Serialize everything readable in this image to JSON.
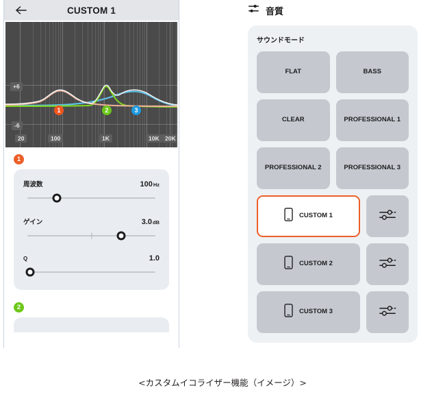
{
  "caption": "<カスタムイコライザー機能（イメージ）>",
  "phone": {
    "header": {
      "back_icon": "back-arrow-icon",
      "title": "CUSTOM 1"
    },
    "graph": {
      "y_labels": [
        "+6",
        "-6"
      ],
      "x_labels": [
        "20",
        "100",
        "1K",
        "10K",
        "20K"
      ],
      "markers": [
        {
          "label": "1",
          "color": "#f0561d"
        },
        {
          "label": "2",
          "color": "#6dc81a"
        },
        {
          "label": "3",
          "color": "#1f9be0"
        }
      ]
    },
    "bands": [
      {
        "badge": "1",
        "badge_color": "#ec5f28",
        "params": [
          {
            "label": "周波数",
            "value": "100",
            "unit": "Hz",
            "thumb_pct": 23,
            "has_center_tick": false
          },
          {
            "label": "ゲイン",
            "value": "3.0",
            "unit": "dB",
            "thumb_pct": 73,
            "has_center_tick": true
          },
          {
            "label": "Q",
            "value": "1.0",
            "unit": "",
            "thumb_pct": 2,
            "has_center_tick": false
          }
        ]
      },
      {
        "badge": "2",
        "badge_color": "#6dc81a",
        "params": []
      }
    ]
  },
  "settings": {
    "header": {
      "icon": "tune-sliders-icon",
      "title": "音質"
    },
    "sound_mode": {
      "title": "サウンドモード",
      "presets": [
        {
          "label": "FLAT"
        },
        {
          "label": "BASS"
        },
        {
          "label": "CLEAR"
        },
        {
          "label": "PROFESSIONAL\n1"
        },
        {
          "label": "PROFESSIONAL\n2"
        },
        {
          "label": "PROFESSIONAL\n3"
        }
      ],
      "customs": [
        {
          "label": "CUSTOM\n1",
          "selected": true,
          "device_icon": "phone-icon",
          "edit_icon": "equalizer-icon"
        },
        {
          "label": "CUSTOM\n2",
          "selected": false,
          "device_icon": "phone-icon",
          "edit_icon": "equalizer-icon"
        },
        {
          "label": "CUSTOM\n3",
          "selected": false,
          "device_icon": "phone-icon",
          "edit_icon": "equalizer-icon"
        }
      ]
    }
  },
  "colors": {
    "accent": "#ec5f28",
    "marker_orange": "#f0561d",
    "marker_green": "#6dc81a",
    "marker_blue": "#1f9be0",
    "panel_bg": "#eef1f4",
    "button_bg": "#c5c9cf",
    "graph_bg": "#4a4a4a"
  }
}
